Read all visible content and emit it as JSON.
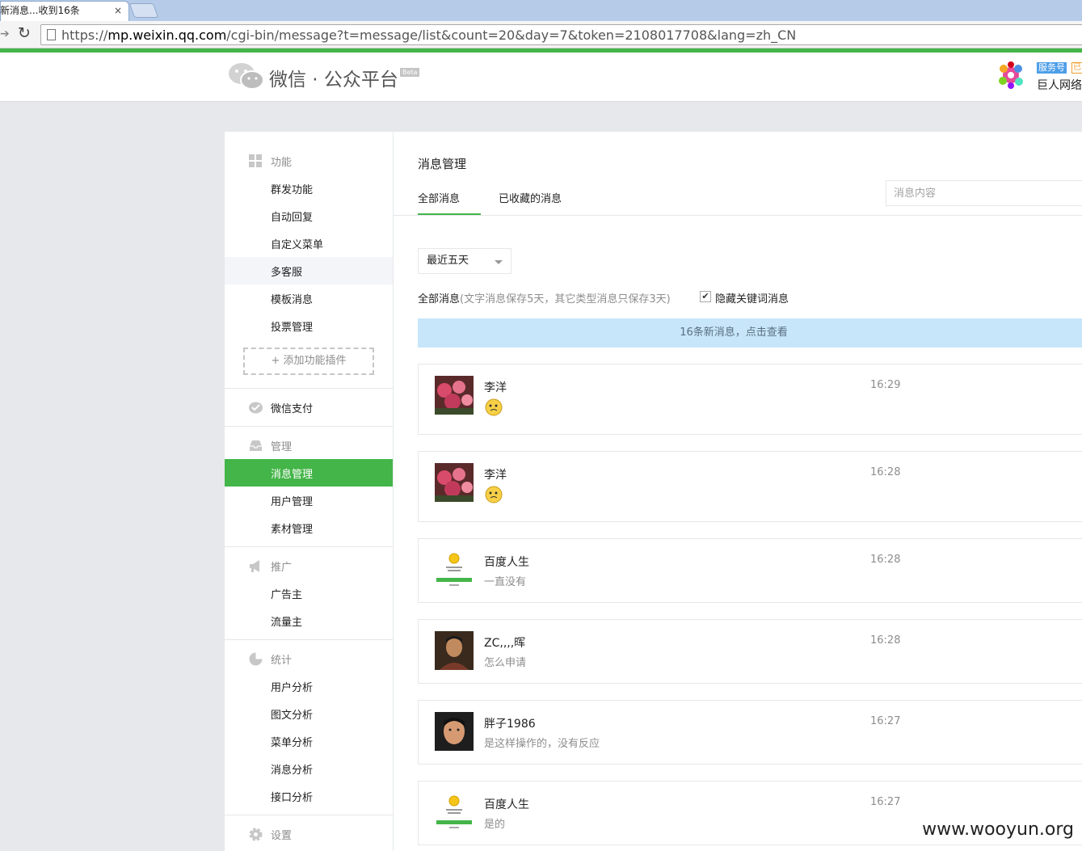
{
  "browser": {
    "tab_title": "新消息...收到16条",
    "tab_close": "×",
    "url_prefix": "https://",
    "url_host": "mp.weixin.qq.com",
    "url_path": "/cgi-bin/message?t=message/list&count=20&day=7&token=2108017708&lang=zh_CN"
  },
  "header": {
    "logo_text": "微信 · 公众平台",
    "beta": "Beta",
    "account_badge": "服务号",
    "account_badge2": "已",
    "account_name": "巨人网络"
  },
  "sidebar": {
    "function_head": "功能",
    "function_items": [
      "群发功能",
      "自动回复",
      "自定义菜单",
      "多客服",
      "模板消息",
      "投票管理"
    ],
    "add_plugin": "添加功能插件",
    "pay_head": "微信支付",
    "manage_head": "管理",
    "manage_items": [
      "消息管理",
      "用户管理",
      "素材管理"
    ],
    "promo_head": "推广",
    "promo_items": [
      "广告主",
      "流量主"
    ],
    "stats_head": "统计",
    "stats_items": [
      "用户分析",
      "图文分析",
      "菜单分析",
      "消息分析",
      "接口分析"
    ],
    "settings_head": "设置"
  },
  "main": {
    "title": "消息管理",
    "tabs": [
      "全部消息",
      "已收藏的消息"
    ],
    "search_placeholder": "消息内容",
    "period": "最近五天",
    "info_label": "全部消息",
    "info_note": "(文字消息保存5天，其它类型消息只保存3天)",
    "checkbox_mark": "✔",
    "hide_keyword_label": "隐藏关键词消息",
    "new_banner": "16条新消息，点击查看",
    "messages": [
      {
        "name": "李洋",
        "text": "",
        "time": "16:29",
        "avatar": "flowers",
        "emoji": true
      },
      {
        "name": "李洋",
        "text": "",
        "time": "16:28",
        "avatar": "flowers",
        "emoji": true
      },
      {
        "name": "百度人生",
        "text": "一直没有",
        "time": "16:28",
        "avatar": "coin",
        "emoji": false
      },
      {
        "name": "ZC,,,,晖",
        "text": "怎么申请",
        "time": "16:28",
        "avatar": "person",
        "emoji": false
      },
      {
        "name": "胖子1986",
        "text": "是这样操作的，没有反应",
        "time": "16:27",
        "avatar": "face",
        "emoji": false
      },
      {
        "name": "百度人生",
        "text": "是的",
        "time": "16:27",
        "avatar": "coin",
        "emoji": false
      }
    ]
  },
  "watermark": "www.wooyun.org"
}
